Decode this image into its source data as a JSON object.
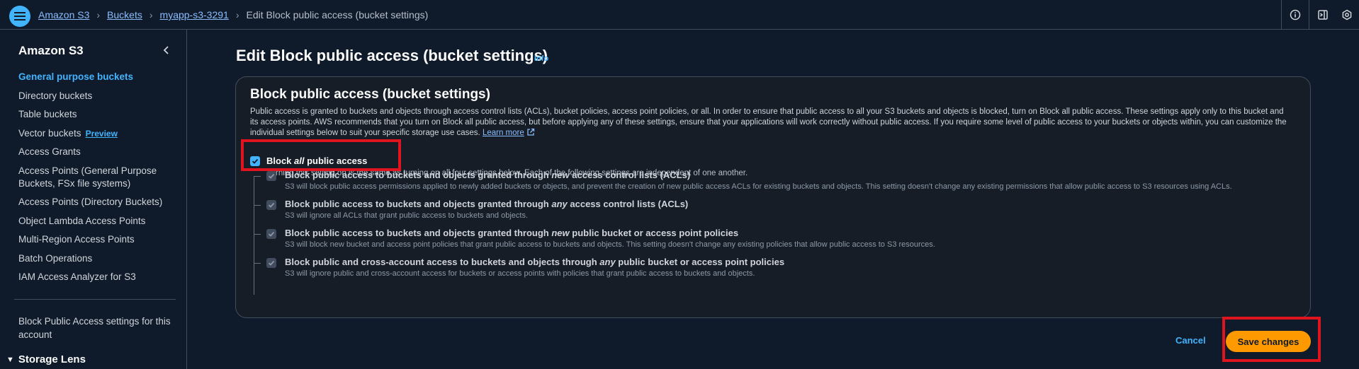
{
  "breadcrumb": {
    "items": [
      "Amazon S3",
      "Buckets",
      "myapp-s3-3291"
    ],
    "current": "Edit Block public access (bucket settings)"
  },
  "sidebar": {
    "title": "Amazon S3",
    "items": [
      {
        "label": "General purpose buckets",
        "active": true
      },
      {
        "label": "Directory buckets"
      },
      {
        "label": "Table buckets"
      },
      {
        "label": "Vector buckets",
        "badge": "Preview"
      },
      {
        "label": "Access Grants"
      },
      {
        "label": "Access Points (General Purpose Buckets, FSx file systems)"
      },
      {
        "label": "Access Points (Directory Buckets)"
      },
      {
        "label": "Object Lambda Access Points"
      },
      {
        "label": "Multi-Region Access Points"
      },
      {
        "label": "Batch Operations"
      },
      {
        "label": "IAM Access Analyzer for S3"
      }
    ],
    "block_public_access_link": "Block Public Access settings for this account",
    "storage_lens": "Storage Lens"
  },
  "page": {
    "title": "Edit Block public access (bucket settings)",
    "info_link": "Info"
  },
  "panel": {
    "title": "Block public access (bucket settings)",
    "description": "Public access is granted to buckets and objects through access control lists (ACLs), bucket policies, access point policies, or all. In order to ensure that public access to all your S3 buckets and objects is blocked, turn on Block all public access. These settings apply only to this bucket and its access points. AWS recommends that you turn on Block all public access, but before applying any of these settings, ensure that your applications will work correctly without public access. If you require some level of public access to your buckets or objects within, you can customize the individual settings below to suit your specific storage use cases.",
    "learn_more": "Learn more",
    "block_all": {
      "label_pre": "Block ",
      "label_em": "all",
      "label_post": " public access",
      "hint": "Turning this setting on is the same as turning on all four settings below. Each of the following settings are independent of one another.",
      "checked": true
    },
    "settings": [
      {
        "label_pre": "Block public access to buckets and objects granted through ",
        "label_em": "new",
        "label_post": " access control lists (ACLs)",
        "desc": "S3 will block public access permissions applied to newly added buckets or objects, and prevent the creation of new public access ACLs for existing buckets and objects. This setting doesn't change any existing permissions that allow public access to S3 resources using ACLs.",
        "checked": true
      },
      {
        "label_pre": "Block public access to buckets and objects granted through ",
        "label_em": "any",
        "label_post": " access control lists (ACLs)",
        "desc": "S3 will ignore all ACLs that grant public access to buckets and objects.",
        "checked": true
      },
      {
        "label_pre": "Block public access to buckets and objects granted through ",
        "label_em": "new",
        "label_post": " public bucket or access point policies",
        "desc": "S3 will block new bucket and access point policies that grant public access to buckets and objects. This setting doesn't change any existing policies that allow public access to S3 resources.",
        "checked": true
      },
      {
        "label_pre": "Block public and cross-account access to buckets and objects through ",
        "label_em": "any",
        "label_post": " public bucket or access point policies",
        "desc": "S3 will ignore public and cross-account access for buckets or access points with policies that grant public access to buckets and objects.",
        "checked": true
      }
    ]
  },
  "actions": {
    "cancel": "Cancel",
    "save": "Save changes"
  },
  "colors": {
    "accent": "#42b4ff",
    "primary_button": "#ff9900",
    "highlight": "#e0141e"
  }
}
